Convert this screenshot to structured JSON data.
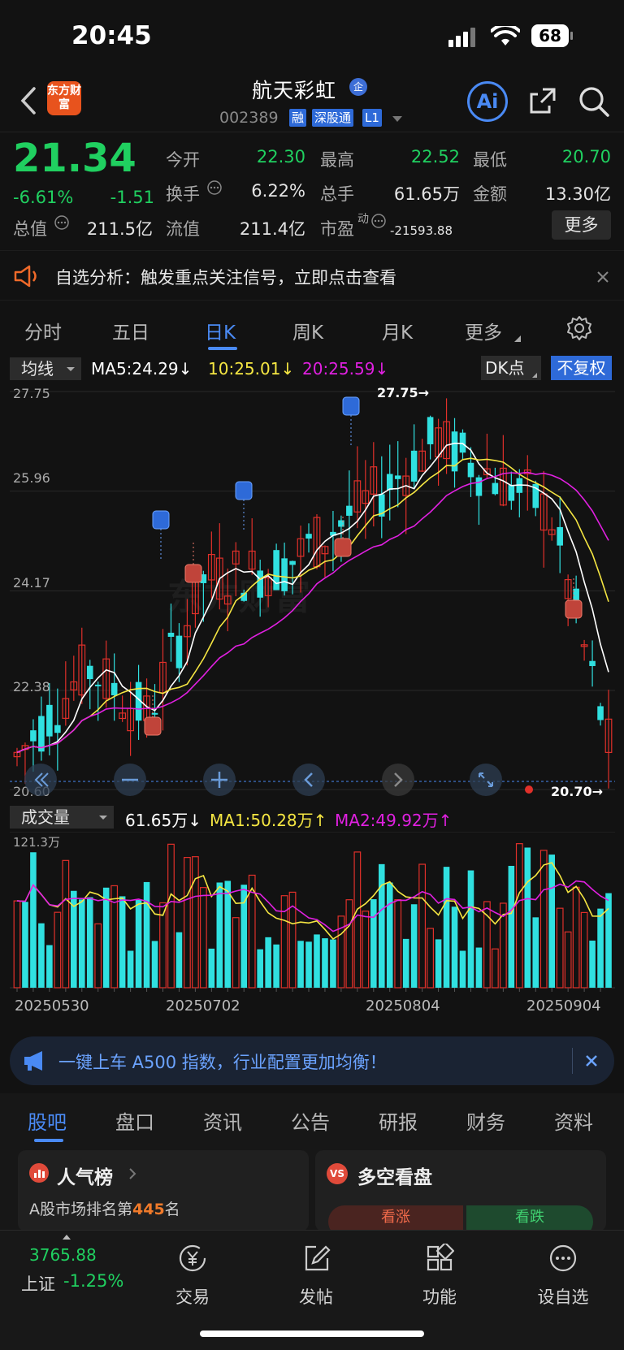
{
  "status": {
    "time": "20:45",
    "battery": "68"
  },
  "header": {
    "logo_text": "东方财富",
    "stock_name": "航天彩虹",
    "qi_badge": "企",
    "code": "002389",
    "tags": [
      "融",
      "深股通",
      "L1"
    ],
    "ai_label": "Ai"
  },
  "quote": {
    "price": "21.34",
    "pct": "-6.61%",
    "chg": "-1.51",
    "fields": {
      "open": {
        "label": "今开",
        "value": "22.30"
      },
      "high": {
        "label": "最高",
        "value": "22.52"
      },
      "low": {
        "label": "最低",
        "value": "20.70"
      },
      "turnover": {
        "label": "换手",
        "value": "6.22%"
      },
      "volume": {
        "label": "总手",
        "value": "61.65万"
      },
      "amount": {
        "label": "金额",
        "value": "13.30亿"
      },
      "mktcap": {
        "label": "总值",
        "value": "211.5亿"
      },
      "float": {
        "label": "流值",
        "value": "211.4亿"
      },
      "pe": {
        "label": "市盈",
        "sup": "动",
        "value": "-21593.88"
      }
    },
    "more": "更多"
  },
  "notice": {
    "text": "自选分析：触发重点关注信号，立即点击查看"
  },
  "period_tabs": [
    "分时",
    "五日",
    "日K",
    "周K",
    "月K",
    "更多"
  ],
  "active_period": "日K",
  "ma": {
    "selector": "均线",
    "ma5": "MA5:24.29↓",
    "ma10": "10:25.01↓",
    "ma20": "20:25.59↓",
    "dk": "DK点",
    "fuquan": "不复权",
    "colors": {
      "ma5": "#ffffff",
      "ma10": "#f5e642",
      "ma20": "#e020e0"
    }
  },
  "kline": {
    "y_labels": [
      "27.75",
      "25.96",
      "24.17",
      "22.38",
      "20.60"
    ],
    "high_marker": "27.75→",
    "low_marker": "20.70→"
  },
  "vol": {
    "selector": "成交量",
    "value": "61.65万↓",
    "ma1": "MA1:50.28万↑",
    "ma2": "MA2:49.92万↑",
    "max_label": "121.3万",
    "dates": [
      "20250530",
      "20250702",
      "20250804",
      "20250904"
    ]
  },
  "banner": {
    "text": "一键上车 A500 指数，行业配置更加均衡！"
  },
  "section_tabs": [
    "股吧",
    "盘口",
    "资讯",
    "公告",
    "研报",
    "财务",
    "资料"
  ],
  "cards": {
    "popular": {
      "title": "人气榜",
      "rank_prefix": "A股市场排名第",
      "rank": "445",
      "rank_suffix": "名"
    },
    "longshort": {
      "title": "多空看盘",
      "up": "看涨",
      "down": "看跌"
    }
  },
  "bottom_nav": {
    "index_value": "3765.88",
    "index_name": "上证",
    "index_pct": "-1.25%",
    "items": [
      "交易",
      "发帖",
      "功能",
      "设自选"
    ]
  },
  "colors": {
    "up": "#e0302a",
    "down": "#30e0e0",
    "accent": "#4a8af4",
    "green": "#20d060"
  }
}
